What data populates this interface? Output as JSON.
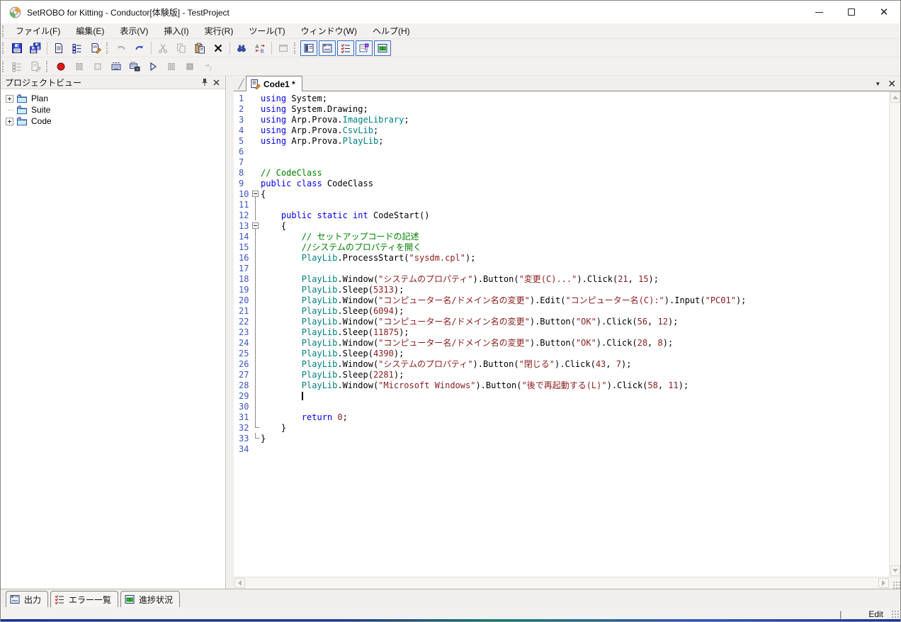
{
  "window": {
    "title": "SetROBO for Kitting - Conductor[体験版] - TestProject"
  },
  "menu": {
    "items": [
      {
        "label": "ファイル(F)"
      },
      {
        "label": "編集(E)"
      },
      {
        "label": "表示(V)"
      },
      {
        "label": "挿入(I)"
      },
      {
        "label": "実行(R)"
      },
      {
        "label": "ツール(T)"
      },
      {
        "label": "ウィンドウ(W)"
      },
      {
        "label": "ヘルプ(H)"
      }
    ]
  },
  "toolbars": {
    "row1": [
      {
        "type": "grip"
      },
      {
        "name": "save-button",
        "icon": "save-icon",
        "enabled": true
      },
      {
        "name": "save-all-button",
        "icon": "save-all-icon",
        "enabled": true
      },
      {
        "type": "sep"
      },
      {
        "name": "new-plan-button",
        "icon": "doc-plan-icon",
        "enabled": true
      },
      {
        "name": "new-suite-button",
        "icon": "doc-suite-icon",
        "enabled": true
      },
      {
        "name": "new-code-button",
        "icon": "doc-edit-icon",
        "enabled": true
      },
      {
        "type": "grip"
      },
      {
        "name": "undo-button",
        "icon": "undo-icon",
        "enabled": false
      },
      {
        "name": "redo-button",
        "icon": "redo-icon",
        "enabled": true
      },
      {
        "type": "sep"
      },
      {
        "name": "cut-button",
        "icon": "cut-icon",
        "enabled": false
      },
      {
        "name": "copy-button",
        "icon": "copy-icon",
        "enabled": false
      },
      {
        "name": "paste-button",
        "icon": "paste-icon",
        "enabled": true
      },
      {
        "name": "delete-button",
        "icon": "delete-icon",
        "enabled": true
      },
      {
        "type": "sep"
      },
      {
        "name": "find-button",
        "icon": "find-icon",
        "enabled": true
      },
      {
        "name": "replace-button",
        "icon": "replace-icon",
        "enabled": true
      },
      {
        "type": "sep"
      },
      {
        "name": "properties-button",
        "icon": "properties-icon",
        "enabled": false
      },
      {
        "type": "grip"
      },
      {
        "name": "toggle-project-view-button",
        "icon": "view-project-icon",
        "enabled": true,
        "toggled": true
      },
      {
        "name": "toggle-output-button",
        "icon": "view-output-icon",
        "enabled": true,
        "toggled": true
      },
      {
        "name": "toggle-error-list-button",
        "icon": "view-errors-icon",
        "enabled": true,
        "toggled": true
      },
      {
        "name": "toggle-flag-button",
        "icon": "view-flag-icon",
        "enabled": true,
        "toggled": true
      },
      {
        "name": "toggle-progress-button",
        "icon": "view-progress-icon",
        "enabled": true,
        "toggled": true
      }
    ],
    "row2": [
      {
        "type": "grip"
      },
      {
        "name": "suite-list-button",
        "icon": "doc-suite-gray-icon",
        "enabled": false
      },
      {
        "name": "code-edit-button",
        "icon": "doc-edit-gray-icon",
        "enabled": false
      },
      {
        "type": "grip"
      },
      {
        "name": "record-button",
        "icon": "record-icon",
        "enabled": true
      },
      {
        "name": "record-pause-button",
        "icon": "pause-gray-icon",
        "enabled": false
      },
      {
        "name": "record-stop-button",
        "icon": "stop-outline-gray-icon",
        "enabled": false
      },
      {
        "name": "keyboard-record-button",
        "icon": "keyboard-icon",
        "enabled": true
      },
      {
        "name": "keyboard-camera-button",
        "icon": "keyboard-camera-icon",
        "enabled": true
      },
      {
        "name": "play-button",
        "icon": "play-icon",
        "enabled": true
      },
      {
        "name": "play-pause-button",
        "icon": "pause-gray-icon",
        "enabled": false
      },
      {
        "name": "play-stop-button",
        "icon": "stop-fill-gray-icon",
        "enabled": false
      },
      {
        "name": "step-button",
        "icon": "step-gray-icon",
        "enabled": false
      }
    ]
  },
  "project_view": {
    "title": "プロジェクトビュー",
    "items": [
      {
        "label": "Plan",
        "expandable": true
      },
      {
        "label": "Suite",
        "expandable": false
      },
      {
        "label": "Code",
        "expandable": true
      }
    ]
  },
  "editor": {
    "tab_label": "Code1 *",
    "lines": [
      {
        "n": 1,
        "f": "",
        "seg": [
          [
            "k",
            "using "
          ],
          [
            "p",
            "System;"
          ]
        ]
      },
      {
        "n": 2,
        "f": "",
        "seg": [
          [
            "k",
            "using "
          ],
          [
            "p",
            "System.Drawing;"
          ]
        ]
      },
      {
        "n": 3,
        "f": "",
        "seg": [
          [
            "k",
            "using "
          ],
          [
            "p",
            "Arp.Prova."
          ],
          [
            "c",
            "ImageLibrary"
          ],
          [
            "p",
            ";"
          ]
        ]
      },
      {
        "n": 4,
        "f": "",
        "seg": [
          [
            "k",
            "using "
          ],
          [
            "p",
            "Arp.Prova."
          ],
          [
            "c",
            "CsvLib"
          ],
          [
            "p",
            ";"
          ]
        ]
      },
      {
        "n": 5,
        "f": "",
        "seg": [
          [
            "k",
            "using "
          ],
          [
            "p",
            "Arp.Prova."
          ],
          [
            "c",
            "PlayLib"
          ],
          [
            "p",
            ";"
          ]
        ]
      },
      {
        "n": 6,
        "f": "",
        "seg": []
      },
      {
        "n": 7,
        "f": "",
        "seg": []
      },
      {
        "n": 8,
        "f": "",
        "seg": [
          [
            "m",
            "// CodeClass"
          ]
        ]
      },
      {
        "n": 9,
        "f": "",
        "seg": [
          [
            "k",
            "public class "
          ],
          [
            "p",
            "CodeClass"
          ]
        ]
      },
      {
        "n": 10,
        "f": "box",
        "seg": [
          [
            "p",
            "{"
          ]
        ]
      },
      {
        "n": 11,
        "f": "line",
        "seg": []
      },
      {
        "n": 12,
        "f": "line",
        "seg": [
          [
            "p",
            "    "
          ],
          [
            "k",
            "public static int "
          ],
          [
            "p",
            "CodeStart()"
          ]
        ]
      },
      {
        "n": 13,
        "f": "box",
        "seg": [
          [
            "p",
            "    {"
          ]
        ]
      },
      {
        "n": 14,
        "f": "line",
        "seg": [
          [
            "p",
            "        "
          ],
          [
            "m",
            "// セットアップコードの記述"
          ]
        ]
      },
      {
        "n": 15,
        "f": "line",
        "seg": [
          [
            "p",
            "        "
          ],
          [
            "m",
            "//システムのプロパティを開く"
          ]
        ]
      },
      {
        "n": 16,
        "f": "line",
        "seg": [
          [
            "p",
            "        "
          ],
          [
            "c",
            "PlayLib"
          ],
          [
            "p",
            ".ProcessStart("
          ],
          [
            "s",
            "\"sysdm.cpl\""
          ],
          [
            "p",
            ");"
          ]
        ]
      },
      {
        "n": 17,
        "f": "line",
        "seg": []
      },
      {
        "n": 18,
        "f": "line",
        "seg": [
          [
            "p",
            "        "
          ],
          [
            "c",
            "PlayLib"
          ],
          [
            "p",
            ".Window("
          ],
          [
            "s",
            "\"システムのプロパティ\""
          ],
          [
            "p",
            ").Button("
          ],
          [
            "s",
            "\"変更(C)...\""
          ],
          [
            "p",
            ").Click("
          ],
          [
            "num",
            "21"
          ],
          [
            "p",
            ", "
          ],
          [
            "num",
            "15"
          ],
          [
            "p",
            ");"
          ]
        ]
      },
      {
        "n": 19,
        "f": "line",
        "seg": [
          [
            "p",
            "        "
          ],
          [
            "c",
            "PlayLib"
          ],
          [
            "p",
            ".Sleep("
          ],
          [
            "num",
            "5313"
          ],
          [
            "p",
            ");"
          ]
        ]
      },
      {
        "n": 20,
        "f": "line",
        "seg": [
          [
            "p",
            "        "
          ],
          [
            "c",
            "PlayLib"
          ],
          [
            "p",
            ".Window("
          ],
          [
            "s",
            "\"コンピューター名/ドメイン名の変更\""
          ],
          [
            "p",
            ").Edit("
          ],
          [
            "s",
            "\"コンピューター名(C):\""
          ],
          [
            "p",
            ").Input("
          ],
          [
            "s",
            "\"PC01\""
          ],
          [
            "p",
            ");"
          ]
        ]
      },
      {
        "n": 21,
        "f": "line",
        "seg": [
          [
            "p",
            "        "
          ],
          [
            "c",
            "PlayLib"
          ],
          [
            "p",
            ".Sleep("
          ],
          [
            "num",
            "6094"
          ],
          [
            "p",
            ");"
          ]
        ]
      },
      {
        "n": 22,
        "f": "line",
        "seg": [
          [
            "p",
            "        "
          ],
          [
            "c",
            "PlayLib"
          ],
          [
            "p",
            ".Window("
          ],
          [
            "s",
            "\"コンピューター名/ドメイン名の変更\""
          ],
          [
            "p",
            ").Button("
          ],
          [
            "s",
            "\"OK\""
          ],
          [
            "p",
            ").Click("
          ],
          [
            "num",
            "56"
          ],
          [
            "p",
            ", "
          ],
          [
            "num",
            "12"
          ],
          [
            "p",
            ");"
          ]
        ]
      },
      {
        "n": 23,
        "f": "line",
        "seg": [
          [
            "p",
            "        "
          ],
          [
            "c",
            "PlayLib"
          ],
          [
            "p",
            ".Sleep("
          ],
          [
            "num",
            "11875"
          ],
          [
            "p",
            ");"
          ]
        ]
      },
      {
        "n": 24,
        "f": "line",
        "seg": [
          [
            "p",
            "        "
          ],
          [
            "c",
            "PlayLib"
          ],
          [
            "p",
            ".Window("
          ],
          [
            "s",
            "\"コンピューター名/ドメイン名の変更\""
          ],
          [
            "p",
            ").Button("
          ],
          [
            "s",
            "\"OK\""
          ],
          [
            "p",
            ").Click("
          ],
          [
            "num",
            "28"
          ],
          [
            "p",
            ", "
          ],
          [
            "num",
            "8"
          ],
          [
            "p",
            ");"
          ]
        ]
      },
      {
        "n": 25,
        "f": "line",
        "seg": [
          [
            "p",
            "        "
          ],
          [
            "c",
            "PlayLib"
          ],
          [
            "p",
            ".Sleep("
          ],
          [
            "num",
            "4390"
          ],
          [
            "p",
            ");"
          ]
        ]
      },
      {
        "n": 26,
        "f": "line",
        "seg": [
          [
            "p",
            "        "
          ],
          [
            "c",
            "PlayLib"
          ],
          [
            "p",
            ".Window("
          ],
          [
            "s",
            "\"システムのプロパティ\""
          ],
          [
            "p",
            ").Button("
          ],
          [
            "s",
            "\"閉じる\""
          ],
          [
            "p",
            ").Click("
          ],
          [
            "num",
            "43"
          ],
          [
            "p",
            ", "
          ],
          [
            "num",
            "7"
          ],
          [
            "p",
            ");"
          ]
        ]
      },
      {
        "n": 27,
        "f": "line",
        "seg": [
          [
            "p",
            "        "
          ],
          [
            "c",
            "PlayLib"
          ],
          [
            "p",
            ".Sleep("
          ],
          [
            "num",
            "2281"
          ],
          [
            "p",
            ");"
          ]
        ]
      },
      {
        "n": 28,
        "f": "line",
        "seg": [
          [
            "p",
            "        "
          ],
          [
            "c",
            "PlayLib"
          ],
          [
            "p",
            ".Window("
          ],
          [
            "s",
            "\"Microsoft Windows\""
          ],
          [
            "p",
            ").Button("
          ],
          [
            "s",
            "\"後で再起動する(L)\""
          ],
          [
            "p",
            ").Click("
          ],
          [
            "num",
            "58"
          ],
          [
            "p",
            ", "
          ],
          [
            "num",
            "11"
          ],
          [
            "p",
            ");"
          ]
        ]
      },
      {
        "n": 29,
        "f": "line",
        "seg": [
          [
            "p",
            "        "
          ]
        ],
        "caret": true
      },
      {
        "n": 30,
        "f": "line",
        "seg": []
      },
      {
        "n": 31,
        "f": "line",
        "seg": [
          [
            "p",
            "        "
          ],
          [
            "k",
            "return "
          ],
          [
            "num",
            "0"
          ],
          [
            "p",
            ";"
          ]
        ]
      },
      {
        "n": 32,
        "f": "end",
        "seg": [
          [
            "p",
            "    }"
          ]
        ]
      },
      {
        "n": 33,
        "f": "end",
        "seg": [
          [
            "p",
            "}"
          ]
        ]
      },
      {
        "n": 34,
        "f": "",
        "seg": []
      }
    ]
  },
  "bottom_tabs": [
    {
      "label": "出力",
      "icon": "output-icon"
    },
    {
      "label": "エラー一覧",
      "icon": "error-list-icon"
    },
    {
      "label": "進捗状況",
      "icon": "progress-icon"
    }
  ],
  "status": {
    "separator": "|",
    "mode": "Edit"
  },
  "colors": {
    "keyword": "#0000ee",
    "class_name": "#008080",
    "string": "#8b1c1c",
    "number": "#8b1c1c",
    "comment": "#008000",
    "line_number": "#3a55c8",
    "toggle_border": "#3b6cc0",
    "record_red": "#e01818",
    "progress_green": "#2ec52e"
  }
}
